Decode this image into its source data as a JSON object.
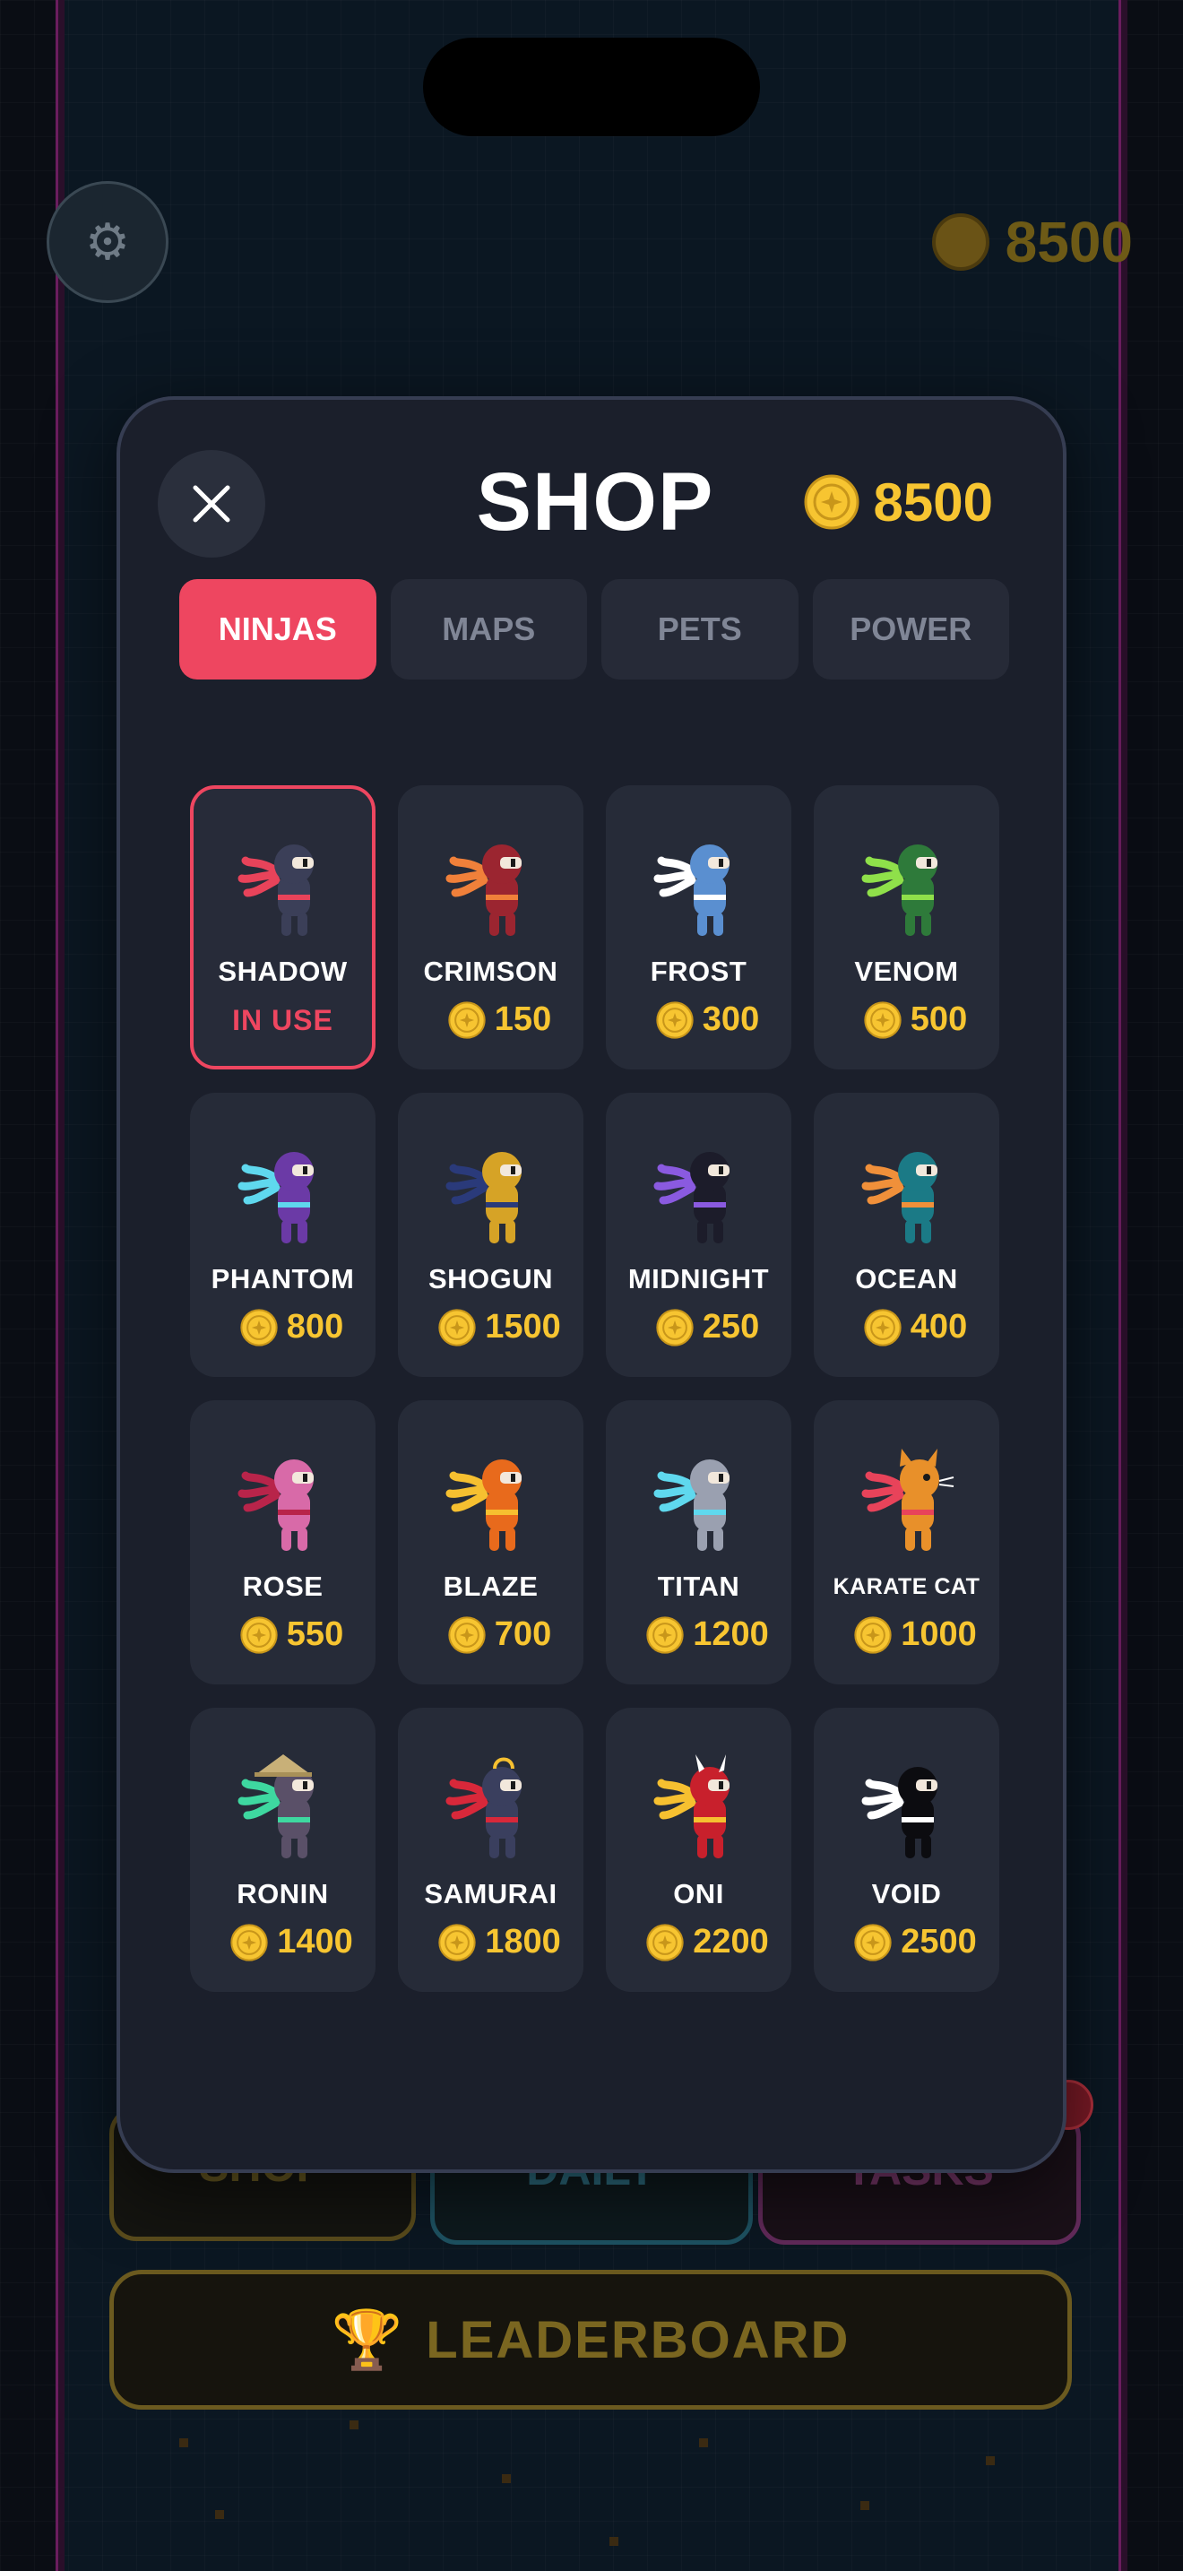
{
  "background": {
    "coin_amount": "8500",
    "buttons": {
      "shop": "SHOP",
      "daily": "DAILY",
      "tasks": "TASKS"
    },
    "leaderboard_label": "LEADERBOARD"
  },
  "modal": {
    "title": "SHOP",
    "coin_amount": "8500",
    "tabs": [
      {
        "label": "NINJAS",
        "active": true
      },
      {
        "label": "MAPS",
        "active": false
      },
      {
        "label": "PETS",
        "active": false
      },
      {
        "label": "POWER",
        "active": false
      }
    ],
    "items": [
      {
        "name": "SHADOW",
        "status": "IN USE",
        "body": "#3b3f58",
        "scarf": "#e8435a",
        "in_use": true
      },
      {
        "name": "CRIMSON",
        "price": "150",
        "body": "#9b2530",
        "scarf": "#f0803a"
      },
      {
        "name": "FROST",
        "price": "300",
        "body": "#5a8fd0",
        "scarf": "#ffffff"
      },
      {
        "name": "VENOM",
        "price": "500",
        "body": "#2e7a3a",
        "scarf": "#8fe04a"
      },
      {
        "name": "PHANTOM",
        "price": "800",
        "body": "#6b3aa6",
        "scarf": "#5fd8ee"
      },
      {
        "name": "SHOGUN",
        "price": "1500",
        "body": "#d6a326",
        "scarf": "#2a3a7a"
      },
      {
        "name": "MIDNIGHT",
        "price": "250",
        "body": "#1c1c2a",
        "scarf": "#8a5ae0"
      },
      {
        "name": "OCEAN",
        "price": "400",
        "body": "#1b7a86",
        "scarf": "#f0903a"
      },
      {
        "name": "ROSE",
        "price": "550",
        "body": "#d86aa8",
        "scarf": "#b8244a"
      },
      {
        "name": "BLAZE",
        "price": "700",
        "body": "#e86a1c",
        "scarf": "#f6c030"
      },
      {
        "name": "TITAN",
        "price": "1200",
        "body": "#9aa0b0",
        "scarf": "#5fd8ee"
      },
      {
        "name": "KARATE CAT",
        "price": "1000",
        "body": "#e8902a",
        "scarf": "#e8435a"
      },
      {
        "name": "RONIN",
        "price": "1400",
        "body": "#5a5068",
        "scarf": "#3ed8a0"
      },
      {
        "name": "SAMURAI",
        "price": "1800",
        "body": "#3a3f5e",
        "scarf": "#d8283a"
      },
      {
        "name": "ONI",
        "price": "2200",
        "body": "#c8202c",
        "scarf": "#f6c030"
      },
      {
        "name": "VOID",
        "price": "2500",
        "body": "#0c0c10",
        "scarf": "#ffffff"
      }
    ]
  },
  "colors": {
    "accent": "#ee4660",
    "coin": "#f7c531",
    "modal_bg": "#1b1f2b",
    "card_bg": "#262b38"
  }
}
